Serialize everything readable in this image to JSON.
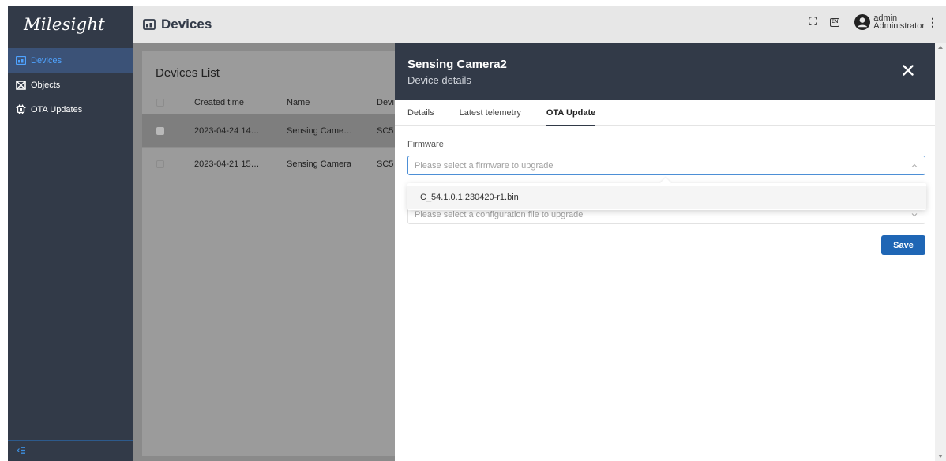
{
  "app": {
    "logo_text": "Milesight"
  },
  "sidebar": {
    "items": [
      {
        "label": "Devices",
        "icon": "devices-icon",
        "active": true
      },
      {
        "label": "Objects",
        "icon": "objects-icon",
        "active": false
      },
      {
        "label": "OTA Updates",
        "icon": "ota-chip-icon",
        "active": false
      }
    ],
    "collapse_icon": "collapse-sidebar-icon"
  },
  "header": {
    "title": "Devices",
    "title_icon": "devices-icon",
    "fullscreen_icon": "fullscreen-icon",
    "language_label": "EN",
    "user": {
      "name": "admin",
      "role": "Administrator"
    }
  },
  "devices_list": {
    "title": "Devices List",
    "columns": [
      "Created time",
      "Name",
      "Devi"
    ],
    "rows": [
      {
        "created": "2023-04-24 14…",
        "name": "Sensing Came…",
        "device": "SC5",
        "selected": true
      },
      {
        "created": "2023-04-21 15…",
        "name": "Sensing Camera",
        "device": "SC5",
        "selected": false
      }
    ]
  },
  "drawer": {
    "title": "Sensing Camera2",
    "subtitle": "Device details",
    "tabs": [
      {
        "label": "Details",
        "active": false
      },
      {
        "label": "Latest telemetry",
        "active": false
      },
      {
        "label": "OTA Update",
        "active": true
      }
    ],
    "firmware_label": "Firmware",
    "firmware_placeholder": "Please select a firmware to upgrade",
    "firmware_options": [
      "C_54.1.0.1.230420-r1.bin"
    ],
    "config_placeholder": "Please select a configuration file to upgrade",
    "save_label": "Save"
  },
  "colors": {
    "sidebar_bg": "#323a48",
    "accent": "#1f66b5",
    "active_nav_text": "#4fa3ff"
  }
}
